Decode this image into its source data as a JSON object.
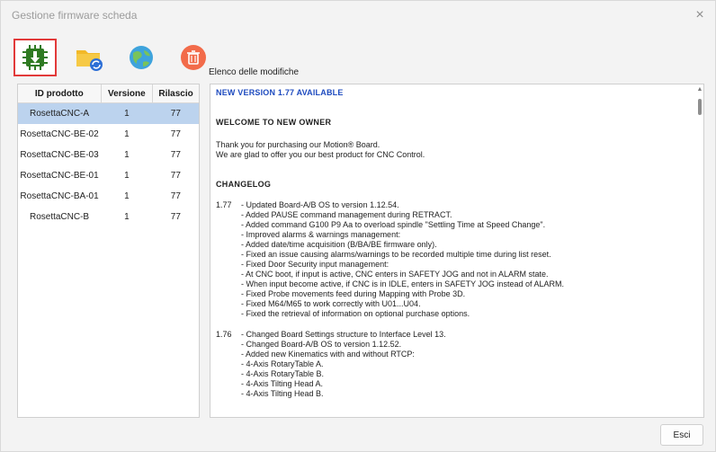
{
  "window": {
    "title": "Gestione firmware scheda",
    "close_glyph": "×"
  },
  "toolbar": {
    "buttons": [
      {
        "icon": "chip-download-icon",
        "selected": true
      },
      {
        "icon": "folder-sync-icon",
        "selected": false
      },
      {
        "icon": "globe-icon",
        "selected": false
      },
      {
        "icon": "trash-icon",
        "selected": false
      }
    ],
    "changes_label": "Elenco delle modifiche"
  },
  "table": {
    "headers": [
      "ID prodotto",
      "Versione",
      "Rilascio"
    ],
    "rows": [
      {
        "id": "RosettaCNC-A",
        "version": "1",
        "release": "77",
        "selected": true
      },
      {
        "id": "RosettaCNC-BE-02",
        "version": "1",
        "release": "77",
        "selected": false
      },
      {
        "id": "RosettaCNC-BE-03",
        "version": "1",
        "release": "77",
        "selected": false
      },
      {
        "id": "RosettaCNC-BE-01",
        "version": "1",
        "release": "77",
        "selected": false
      },
      {
        "id": "RosettaCNC-BA-01",
        "version": "1",
        "release": "77",
        "selected": false
      },
      {
        "id": "RosettaCNC-B",
        "version": "1",
        "release": "77",
        "selected": false
      }
    ]
  },
  "changelog": {
    "new_version": "NEW VERSION 1.77 AVAILABLE",
    "welcome_heading": "WELCOME TO NEW OWNER",
    "thanks": [
      "Thank you for purchasing our Motion® Board.",
      "We are glad to offer you our best product for CNC Control."
    ],
    "changelog_heading": "CHANGELOG",
    "entries": [
      {
        "version": "1.77",
        "lines": [
          "- Updated Board-A/B OS to version 1.12.54.",
          "- Added PAUSE command management during RETRACT.",
          "- Added command G100 P9 Aa to overload spindle \"Settling Time at Speed Change\".",
          "- Improved alarms & warnings management:",
          "    - Added date/time acquisition (B/BA/BE firmware only).",
          "    - Fixed an issue causing alarms/warnings to be recorded multiple time during list reset.",
          "- Fixed Door Security input management:",
          "    - At CNC boot, if input is active, CNC enters in SAFETY JOG and not in ALARM state.",
          "    - When input become active, if CNC is in IDLE, enters in SAFETY JOG instead of ALARM.",
          "- Fixed Probe movements feed during Mapping with Probe 3D.",
          "- Fixed M64/M65 to work correctly with U01...U04.",
          "- Fixed the retrieval of information on optional purchase options."
        ]
      },
      {
        "version": "1.76",
        "lines": [
          "- Changed Board Settings structure to Interface Level 13.",
          "- Changed Board-A/B OS to version 1.12.52.",
          "- Added new Kinematics with and without RTCP:",
          "    - 4-Axis RotaryTable A.",
          "    - 4-Axis RotaryTable B.",
          "    - 4-Axis Tilting Head A.",
          "    - 4-Axis Tilting Head B."
        ]
      }
    ]
  },
  "footer": {
    "exit_label": "Esci"
  },
  "colors": {
    "accent_selection": "#bcd3ee",
    "new_version_blue": "#1e4bbf",
    "selected_tool_border": "#e23a3a"
  }
}
